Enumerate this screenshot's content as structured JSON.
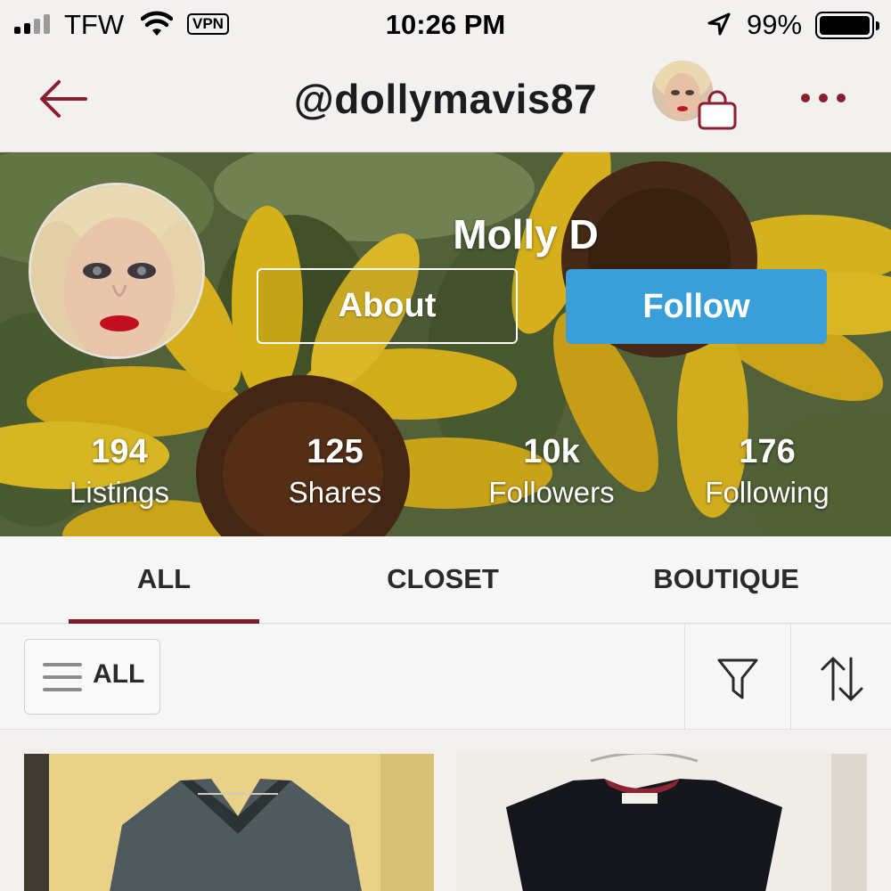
{
  "status_bar": {
    "carrier": "TFW",
    "vpn": "VPN",
    "time": "10:26 PM",
    "battery": "99%",
    "battery_level": 0.99
  },
  "nav": {
    "title": "@dollymavis87",
    "back_icon": "back-arrow-icon",
    "bag_icon": "shopping-bag-icon",
    "more_icon": "more-dots-icon",
    "accent_color": "#8b1f2e"
  },
  "profile": {
    "display_name": "Molly D",
    "about_label": "About",
    "follow_label": "Follow",
    "follow_color": "#3a9fd9"
  },
  "stats": [
    {
      "num": "194",
      "label": "Listings"
    },
    {
      "num": "125",
      "label": "Shares"
    },
    {
      "num": "10k",
      "label": "Followers"
    },
    {
      "num": "176",
      "label": "Following"
    }
  ],
  "tabs": [
    {
      "label": "ALL",
      "active": true
    },
    {
      "label": "CLOSET",
      "active": false
    },
    {
      "label": "BOUTIQUE",
      "active": false
    }
  ],
  "filter_bar": {
    "all_label": "ALL",
    "menu_icon": "hamburger-menu-icon",
    "filter_icon": "filter-funnel-icon",
    "sort_icon": "sort-arrows-icon"
  }
}
